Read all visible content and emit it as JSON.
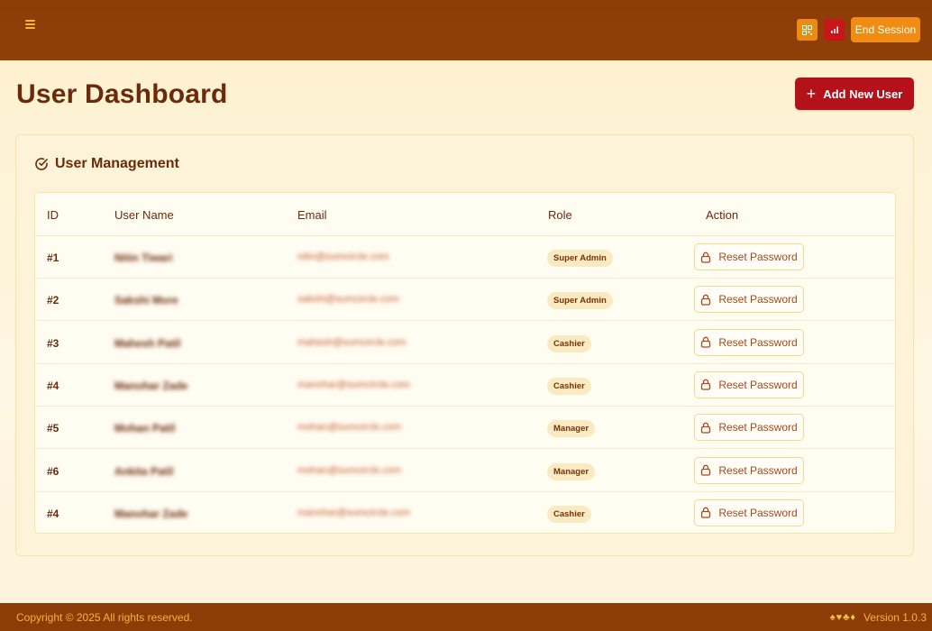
{
  "header": {
    "end_session_label": "End Session",
    "icons": [
      "menu-icon",
      "qr-code-icon",
      "bar-chart-icon"
    ]
  },
  "page": {
    "title": "User Dashboard",
    "add_button_label": "Add New User",
    "card_title": "User Management"
  },
  "table": {
    "columns": {
      "id": "ID",
      "name": "User Name",
      "email": "Email",
      "role": "Role",
      "action": "Action"
    },
    "action_label": "Reset Password",
    "rows": [
      {
        "id": "#1",
        "name": "Nitin Tiwari",
        "email": "nitin@sumcircle.com",
        "role": "Super Admin"
      },
      {
        "id": "#2",
        "name": "Sakshi More",
        "email": "sakshi@sumcircle.com",
        "role": "Super Admin"
      },
      {
        "id": "#3",
        "name": "Mahesh Patil",
        "email": "mahesh@sumcircle.com",
        "role": "Cashier"
      },
      {
        "id": "#4",
        "name": "Manohar Zade",
        "email": "manohar@sumcircle.com",
        "role": "Cashier"
      },
      {
        "id": "#5",
        "name": "Mohan Patil",
        "email": "mohan@sumcircle.com",
        "role": "Manager"
      },
      {
        "id": "#6",
        "name": "Ankita Patil",
        "email": "mohan@sumcircle.com",
        "role": "Manager"
      },
      {
        "id": "#4",
        "name": "Manohar Zade",
        "email": "manohar@sumcircle.com",
        "role": "Cashier"
      }
    ]
  },
  "footer": {
    "copyright": "Copyright © 2025  All rights reserved.",
    "suits": "♠♥♣♦",
    "version": "Version 1.0.3"
  },
  "colors": {
    "header_bg": "#8c3c07",
    "accent_orange": "#ef8c11",
    "accent_red": "#b3121a",
    "page_bg": "#fdf4dc",
    "text_brown": "#6b2a0a"
  }
}
